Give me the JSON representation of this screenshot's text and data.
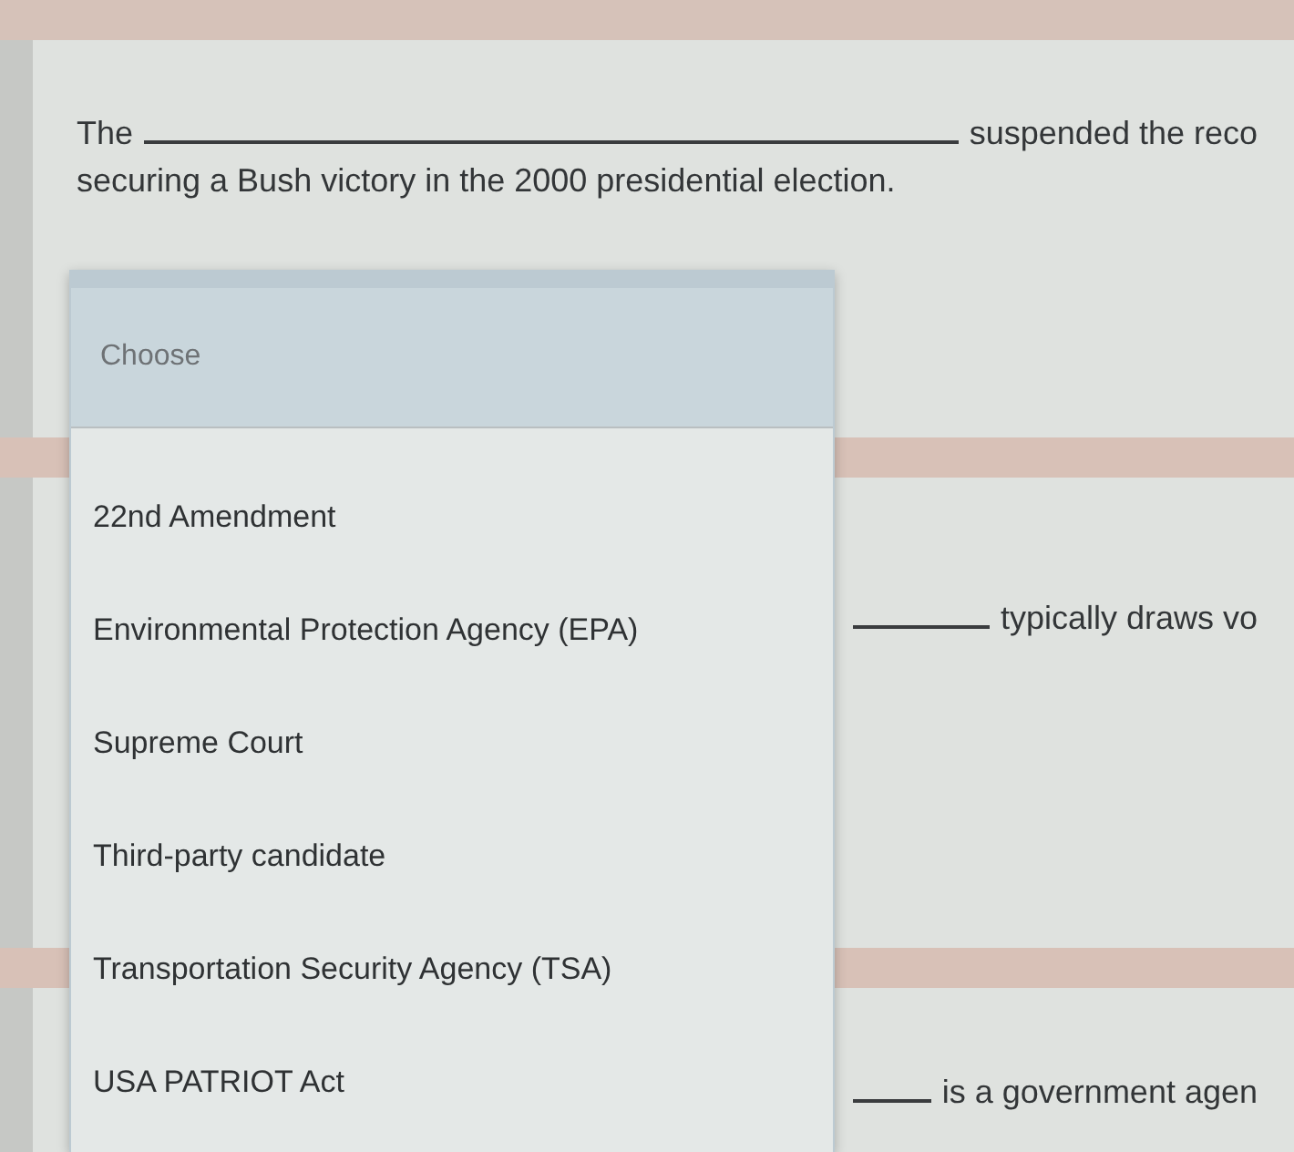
{
  "questions": [
    {
      "lines": [
        {
          "parts": [
            {
              "kind": "text",
              "text": "The"
            },
            {
              "kind": "blank"
            },
            {
              "kind": "text",
              "text": "suspended the reco"
            }
          ]
        },
        {
          "parts": [
            {
              "kind": "text",
              "text": "securing a Bush victory in the 2000 presidential election."
            }
          ]
        }
      ]
    },
    {
      "lines": [
        {
          "parts": [
            {
              "kind": "blank"
            },
            {
              "kind": "text",
              "text": "typically draws vo"
            }
          ]
        }
      ]
    },
    {
      "lines": [
        {
          "parts": [
            {
              "kind": "blank"
            },
            {
              "kind": "text",
              "text": "is a government agen"
            }
          ]
        }
      ]
    }
  ],
  "dropdown": {
    "options": [
      {
        "label": "Choose",
        "kind": "prompt",
        "selected": true
      },
      {
        "label": "22nd Amendment",
        "kind": "option",
        "selected": false
      },
      {
        "label": "Environmental Protection Agency (EPA)",
        "kind": "option",
        "selected": false
      },
      {
        "label": "Supreme Court",
        "kind": "option",
        "selected": false
      },
      {
        "label": "Third-party candidate",
        "kind": "option",
        "selected": false
      },
      {
        "label": "Transportation Security Agency (TSA)",
        "kind": "option",
        "selected": false
      },
      {
        "label": "USA PATRIOT Act",
        "kind": "option",
        "selected": false
      }
    ]
  }
}
